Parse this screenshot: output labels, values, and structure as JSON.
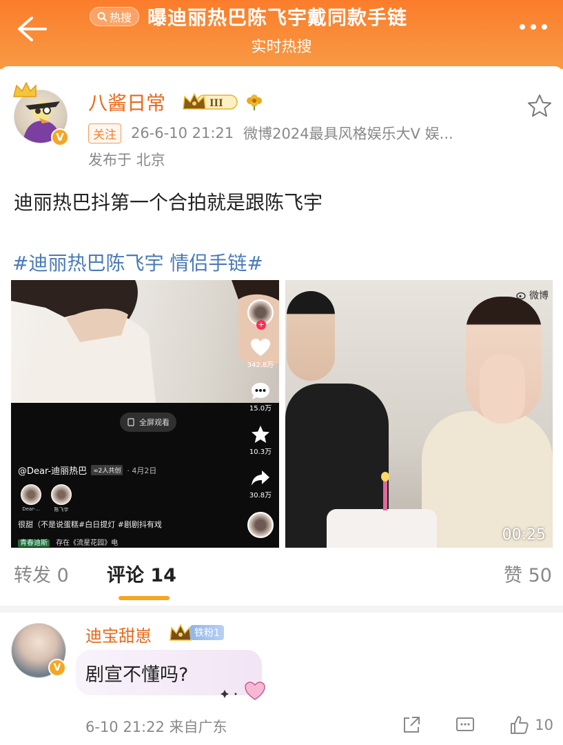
{
  "header": {
    "hot_label": "热搜",
    "title": "曝迪丽热巴陈飞宇戴同款手链",
    "subtitle": "实时热搜"
  },
  "post": {
    "author": "八酱日常",
    "vip_level": "III",
    "follow_label": "关注",
    "time": "26-6-10 21:21",
    "source": "微博2024最具风格娱乐大V 娱...",
    "location": "发布于 北京",
    "text": "迪丽热巴抖第一个合拍就是跟陈飞宇",
    "hashtag": "#迪丽热巴陈飞宇 情侣手链#"
  },
  "video_left": {
    "fullscreen_label": "全屏观看",
    "likes": "342.8万",
    "comments": "15.0万",
    "favorites": "10.3万",
    "shares": "30.8万",
    "username": "@Dear-迪丽热巴",
    "co_create": "∞2人共创",
    "date": "· 4月2日",
    "small_avatar_1": "Dear-...",
    "small_avatar_2": "陈飞宇",
    "description": "很甜（不是说蛋糕#白日提灯 #剧剧抖有戏",
    "music_tag": "青春迪斯",
    "music_text": "存在《流星花园》电"
  },
  "video_right": {
    "watermark": "微博",
    "duration": "00:25"
  },
  "tabs": {
    "repost": "转发 0",
    "comment": "评论 14",
    "like": "赞 50"
  },
  "comment": {
    "author": "迪宝甜崽",
    "fan_badge": "铁粉1",
    "text": "剧宣不懂吗?",
    "meta": "6-10 21:22 来自广东",
    "likes": "10"
  },
  "colors": {
    "header_orange": "#fb7d2b",
    "username_orange": "#e8681a",
    "hashtag_blue": "#4a7ab8",
    "tab_indicator": "#f5a623"
  }
}
